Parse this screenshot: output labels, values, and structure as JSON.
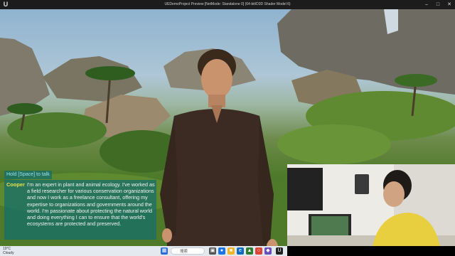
{
  "window": {
    "title": "UEDemoProject Preview [NetMode: Standalone 0] (64-bit/D3D Shader Model 6)"
  },
  "dialogue": {
    "hint": "Hold [Space] to talk",
    "speaker": "Cooper",
    "text": "I'm an expert in plant and animal ecology.  I've worked as a field researcher for various conservation organizations and now I work as a freelance consultant,  offering my expertise to organizations and governments around the world. I'm passionate about protecting the natural world and doing everything I can to ensure that the world's ecosystems are protected and preserved."
  },
  "taskbar": {
    "weather_temp": "19°C",
    "weather_desc": "Cloudy",
    "search_placeholder": "搜索"
  },
  "colors": {
    "caption_bg": "#146e6e",
    "speaker": "#e8e04a",
    "hint": "#9fe0f5"
  }
}
